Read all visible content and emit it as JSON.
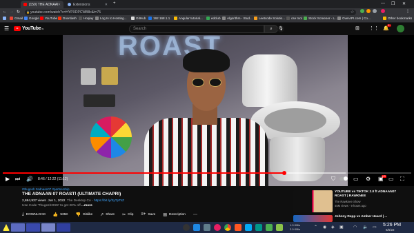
{
  "browser": {
    "tabs": [
      {
        "title": "(150) THE ADNAAN 07 ROAST! (...",
        "active": true,
        "favicon_color": "#ff0000"
      },
      {
        "title": "Extensions",
        "active": false,
        "favicon_color": "#8ab4f8"
      }
    ],
    "new_tab": "+",
    "window_controls": {
      "minimize": "—",
      "maximize": "❐",
      "close": "✕"
    },
    "url": "youtube.com/watch?v=HYPXDPCWB8c&t=75",
    "bookmarks": [
      {
        "label": "Gmail",
        "color": "#ea4335"
      },
      {
        "label": "Google",
        "color": "#4285f4"
      },
      {
        "label": "YouTube",
        "color": "#ff0000"
      },
      {
        "label": "Doordash",
        "color": "#ff3008"
      },
      {
        "label": "Hoqiay",
        "color": "#555"
      },
      {
        "label": "Log In to Hosting...",
        "color": "#888"
      },
      {
        "label": "GitHub",
        "color": "#ddd"
      },
      {
        "label": "192.168.1.1",
        "color": "#1a73e8"
      },
      {
        "label": "Angular tutorial...",
        "color": "#fbbc04"
      },
      {
        "label": "edclub",
        "color": "#34a853"
      },
      {
        "label": "Algorithm - Stud...",
        "color": "#888"
      },
      {
        "label": "Leetcode Solutio...",
        "color": "#f89f1b"
      },
      {
        "label": "cse tool",
        "color": "#555"
      },
      {
        "label": "Stock Screener - L...",
        "color": "#4caf50"
      },
      {
        "label": "OverAPI.com | Co...",
        "color": "#888"
      },
      {
        "label": "Other bookmarks",
        "color": "#fbbc04"
      }
    ]
  },
  "youtube": {
    "logo_text": "YouTube",
    "logo_region": "IN",
    "search_placeholder": "Search",
    "notification_count": "9+"
  },
  "player": {
    "neon_text": "ROAST",
    "progress": 0.6889,
    "buffered": 0.84,
    "time_current": "8:46",
    "time_total": "12:22",
    "time_display": "8:46 / 12:22 (11:12)",
    "hd_badge": "HD"
  },
  "video": {
    "hashtags": "#thugesh #adnaan07 #partnership",
    "title": "THE ADNAAN 07 ROAST! (ULTIMATE CHAPRI)",
    "views": "2,694,937 views",
    "date": "Jun 1, 2022",
    "meta_text": "The Desktop Co - ",
    "meta_link": "https://bit.ly/3yTpTsZ",
    "desc_line": "Use Code 'Thugesh2022' to get 20% off ",
    "desc_link": "https://...",
    "more": "...more",
    "actions": [
      {
        "label": "DOWNLOAD",
        "icon": "download-icon",
        "glyph": "⤓"
      },
      {
        "label": "535K",
        "icon": "like-icon",
        "glyph": "👍"
      },
      {
        "label": "Dislike",
        "icon": "dislike-icon",
        "glyph": "👎"
      },
      {
        "label": "Share",
        "icon": "share-icon",
        "glyph": "↗"
      },
      {
        "label": "Clip",
        "icon": "clip-icon",
        "glyph": "✂"
      },
      {
        "label": "Save",
        "icon": "save-icon",
        "glyph": "≡+"
      },
      {
        "label": "Description",
        "icon": "description-icon",
        "glyph": "▤"
      }
    ]
  },
  "suggestions": [
    {
      "title": "YOUTUBE vs TIKTOK 2.0 ft ADNAAN07 ROAST | RAWKNEE",
      "channel": "The Rawknee Show",
      "stats": "45M views · 9 hours ago",
      "duration": "12:34"
    },
    {
      "title": "Johnny Depp vs Amber Heard | ...",
      "channel": "",
      "stats": "",
      "duration": ""
    }
  ],
  "taskbar": {
    "time": "5:26 PM",
    "date": "6/5/22",
    "net_up": "1.0 KB/s",
    "net_down": "2.0 KB/s"
  }
}
